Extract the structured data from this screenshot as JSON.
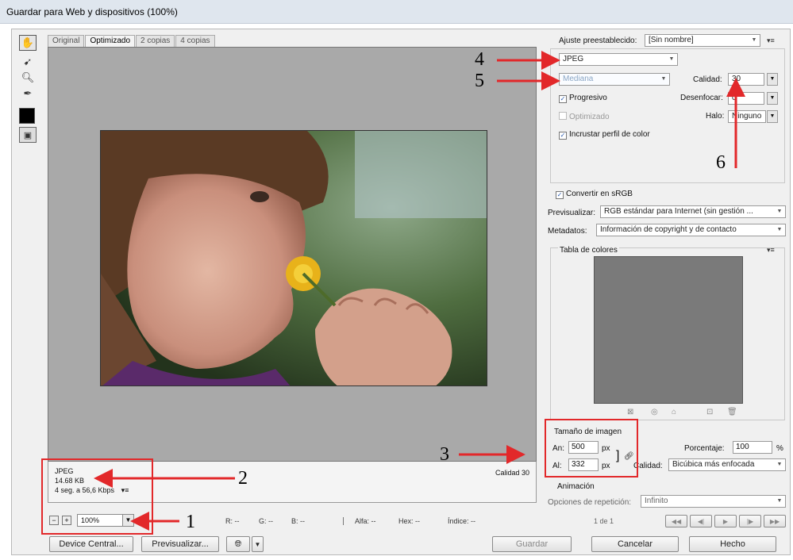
{
  "window": {
    "title": "Guardar para Web y dispositivos (100%)"
  },
  "tools": [
    "hand-tool-icon",
    "slice-select-tool-icon",
    "zoom-tool-icon",
    "eyedropper-tool-icon",
    "eyedropper-color-swatch",
    "toggle-slices-icon"
  ],
  "tabs": [
    "Original",
    "Optimizado",
    "2 copias",
    "4 copias"
  ],
  "info": {
    "format": "JPEG",
    "size": "14.68 KB",
    "time": "4 seg. a 56,6 Kbps",
    "quality": "Calidad 30"
  },
  "status": {
    "zoom": "100%",
    "r": "R: --",
    "g": "G: --",
    "b": "B: --",
    "alpha": "Alfa: --",
    "hex": "Hex: --",
    "index": "Índice: --"
  },
  "buttons": {
    "device_central": "Device Central...",
    "preview": "Previsualizar...",
    "save": "Guardar",
    "cancel": "Cancelar",
    "done": "Hecho"
  },
  "panel": {
    "preset_label": "Ajuste preestablecido:",
    "preset_value": "[Sin nombre]",
    "format": "JPEG",
    "quality_preset": "Mediana",
    "quality_label": "Calidad:",
    "quality_value": "30",
    "blur_label": "Desenfocar:",
    "blur_value": "0",
    "matte_label": "Halo:",
    "matte_value": "Ninguno",
    "progressive": "Progresivo",
    "optimized": "Optimizado",
    "embed_profile": "Incrustar perfil de color",
    "convert_srgb": "Convertir en sRGB",
    "preview_label": "Previsualizar:",
    "preview_value": "RGB estándar para Internet (sin gestión ...",
    "metadata_label": "Metadatos:",
    "metadata_value": "Información de copyright y de contacto",
    "color_table": "Tabla de colores",
    "image_size": "Tamaño de imagen",
    "width_label": "An:",
    "width_value": "500",
    "height_label": "Al:",
    "height_value": "332",
    "px": "px",
    "percent_label": "Porcentaje:",
    "percent_value": "100",
    "percent_unit": "%",
    "quality2_label": "Calidad:",
    "quality2_value": "Bicúbica más enfocada",
    "animation": "Animación",
    "loop_label": "Opciones de repetición:",
    "loop_value": "Infinito",
    "frame": "1 de 1"
  },
  "annotations": [
    "1",
    "2",
    "3",
    "4",
    "5",
    "6"
  ],
  "colors": {
    "annotation": "#e2282a",
    "canvas": "#a9a9a9",
    "color_table": "#7a7a7a"
  }
}
